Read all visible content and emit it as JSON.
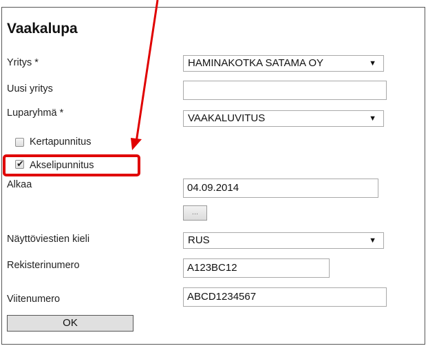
{
  "form": {
    "title": "Vaakalupa",
    "company": {
      "label": "Yritys *",
      "value": "HAMINAKOTKA SATAMA OY"
    },
    "new_company": {
      "label": "Uusi yritys",
      "value": ""
    },
    "permit_group": {
      "label": "Luparyhmä *",
      "value": "VAAKALUVITUS"
    },
    "single_weighing": {
      "label": "Kertapunnitus",
      "checked": false
    },
    "axle_weighing": {
      "label": "Akselipunnitus",
      "checked": true
    },
    "start": {
      "label": "Alkaa",
      "value": "04.09.2014",
      "picker_label": "..."
    },
    "message_language": {
      "label": "Näyttöviestien kieli",
      "value": "RUS"
    },
    "registration_number": {
      "label": "Rekisterinumero",
      "value": "A123BC12"
    },
    "reference_number": {
      "label": "Viitenumero",
      "value": "ABCD1234567"
    },
    "ok_label": "OK"
  },
  "annotation": {
    "color": "#e00000",
    "target": "Akselipunnitus"
  }
}
